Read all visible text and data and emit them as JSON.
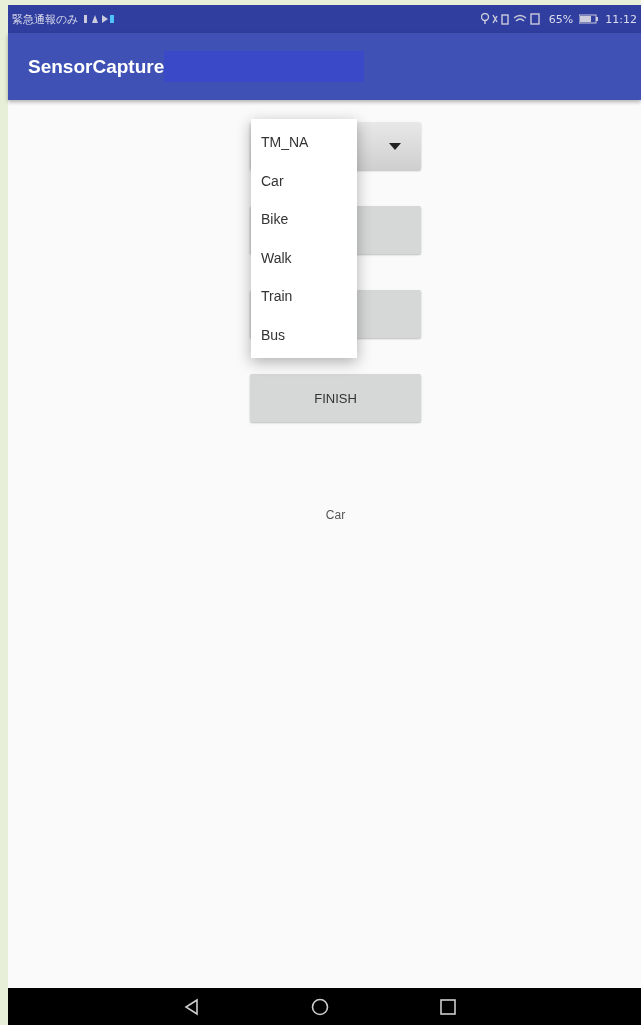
{
  "status_bar": {
    "carrier": "緊急通報のみ",
    "battery_text": "65%",
    "time": "11:12"
  },
  "app_bar": {
    "title": "SensorCapture"
  },
  "buttons": [
    {
      "kind": "spinner"
    },
    {
      "kind": "plain"
    },
    {
      "kind": "plain"
    },
    {
      "kind": "plain",
      "label": "FINISH"
    }
  ],
  "dropdown": {
    "options": [
      {
        "label": "TM_NA"
      },
      {
        "label": "Car"
      },
      {
        "label": "Bike"
      },
      {
        "label": "Walk"
      },
      {
        "label": "Train"
      },
      {
        "label": "Bus"
      }
    ]
  },
  "result_text": "Car"
}
